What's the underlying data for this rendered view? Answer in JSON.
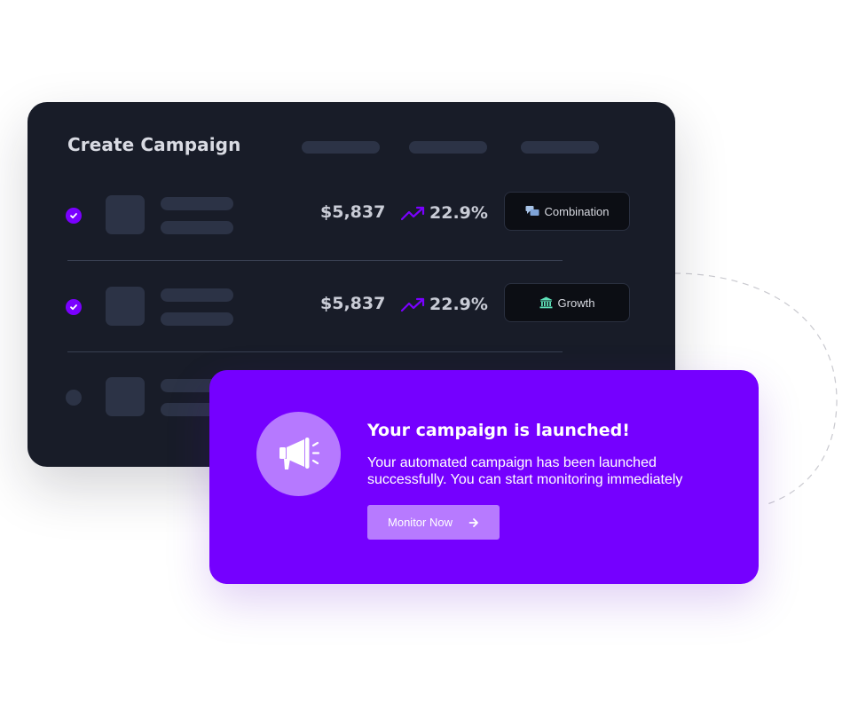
{
  "campaign_card": {
    "title": "Create Campaign",
    "rows": [
      {
        "checked": true,
        "amount": "$5,837",
        "percent": "22.9%",
        "tag_label": "Combination",
        "tag_icon": "chat-bubbles-icon"
      },
      {
        "checked": true,
        "amount": "$5,837",
        "percent": "22.9%",
        "tag_label": "Growth",
        "tag_icon": "bank-icon"
      },
      {
        "checked": false
      }
    ]
  },
  "notification": {
    "icon": "megaphone-icon",
    "title": "Your campaign is launched!",
    "body": "Your automated campaign has been launched successfully. You can start monitoring immediately",
    "button_label": "Monitor Now",
    "button_icon": "arrow-right-icon"
  },
  "colors": {
    "accent": "#7500ff",
    "dark_surface": "#181c28",
    "placeholder": "#2c3346",
    "badge": "#b679ff"
  }
}
